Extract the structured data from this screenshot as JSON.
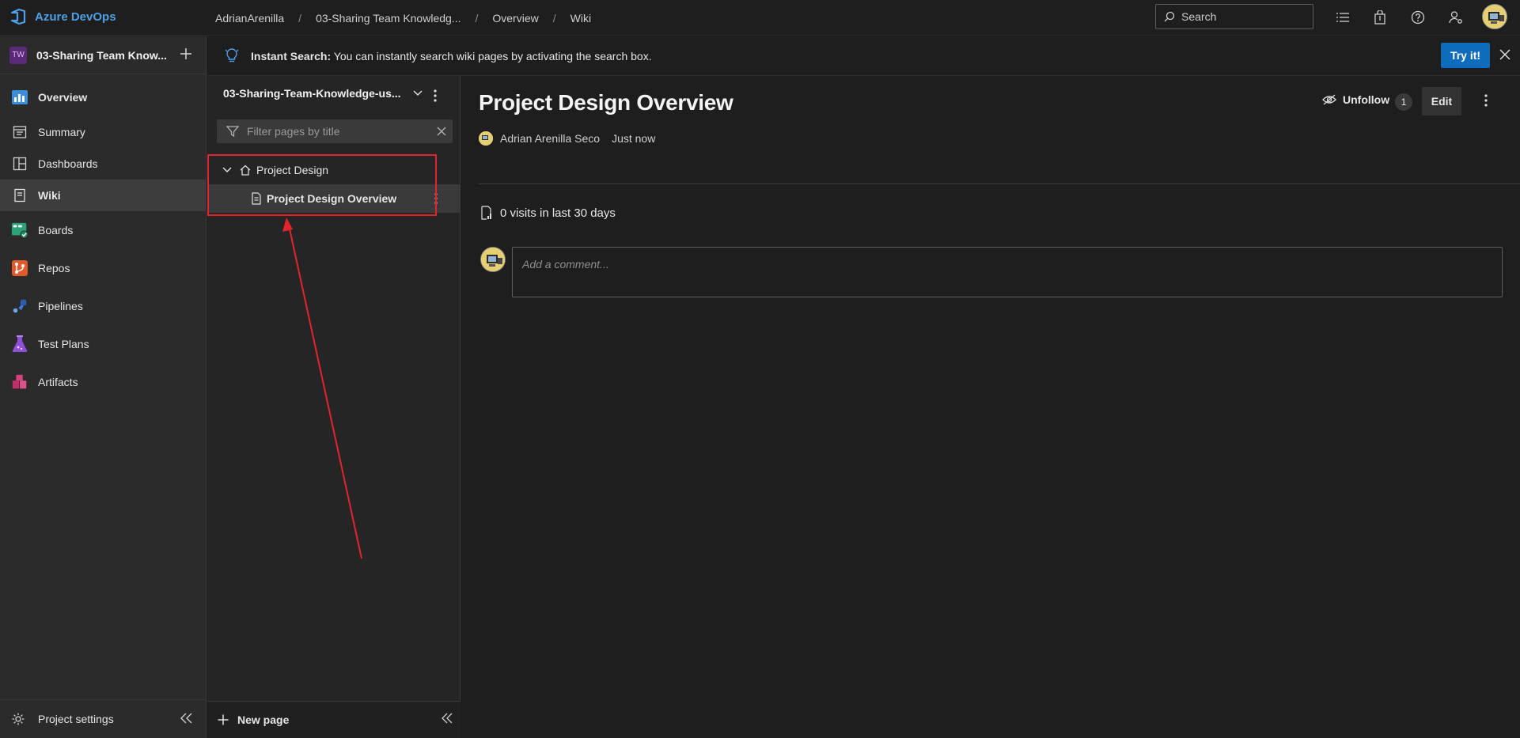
{
  "topbar": {
    "brand": "Azure DevOps",
    "breadcrumbs": [
      "AdrianArenilla",
      "03-Sharing Team Knowledg...",
      "Overview",
      "Wiki"
    ],
    "search_placeholder": "Search"
  },
  "leftnav": {
    "project_badge": "TW",
    "project_name": "03-Sharing Team Know...",
    "items": [
      {
        "label": "Overview",
        "icon": "overview-icon"
      },
      {
        "label": "Summary",
        "icon": "summary-icon"
      },
      {
        "label": "Dashboards",
        "icon": "dashboards-icon"
      },
      {
        "label": "Wiki",
        "icon": "wiki-icon"
      },
      {
        "label": "Boards",
        "icon": "boards-icon"
      },
      {
        "label": "Repos",
        "icon": "repos-icon"
      },
      {
        "label": "Pipelines",
        "icon": "pipelines-icon"
      },
      {
        "label": "Test Plans",
        "icon": "test-plans-icon"
      },
      {
        "label": "Artifacts",
        "icon": "artifacts-icon"
      }
    ],
    "project_settings": "Project settings"
  },
  "banner": {
    "title": "Instant Search:",
    "message": " You can instantly search wiki pages by activating the search box.",
    "try_label": "Try it!"
  },
  "tree": {
    "wiki_name": "03-Sharing-Team-Knowledge-us...",
    "filter_placeholder": "Filter pages by title",
    "nodes": [
      {
        "label": "Project Design"
      },
      {
        "label": "Project Design Overview"
      }
    ],
    "new_page": "New page"
  },
  "page": {
    "title": "Project Design Overview",
    "unfollow": "Unfollow",
    "followers": "1",
    "edit": "Edit",
    "author": "Adrian Arenilla Seco",
    "time": "Just now",
    "visits": "0 visits in last 30 days",
    "comment_placeholder": "Add a comment..."
  },
  "colors": {
    "accent": "#0f6cbd",
    "annotation": "#e3242b",
    "brand": "#4ea0e8"
  }
}
